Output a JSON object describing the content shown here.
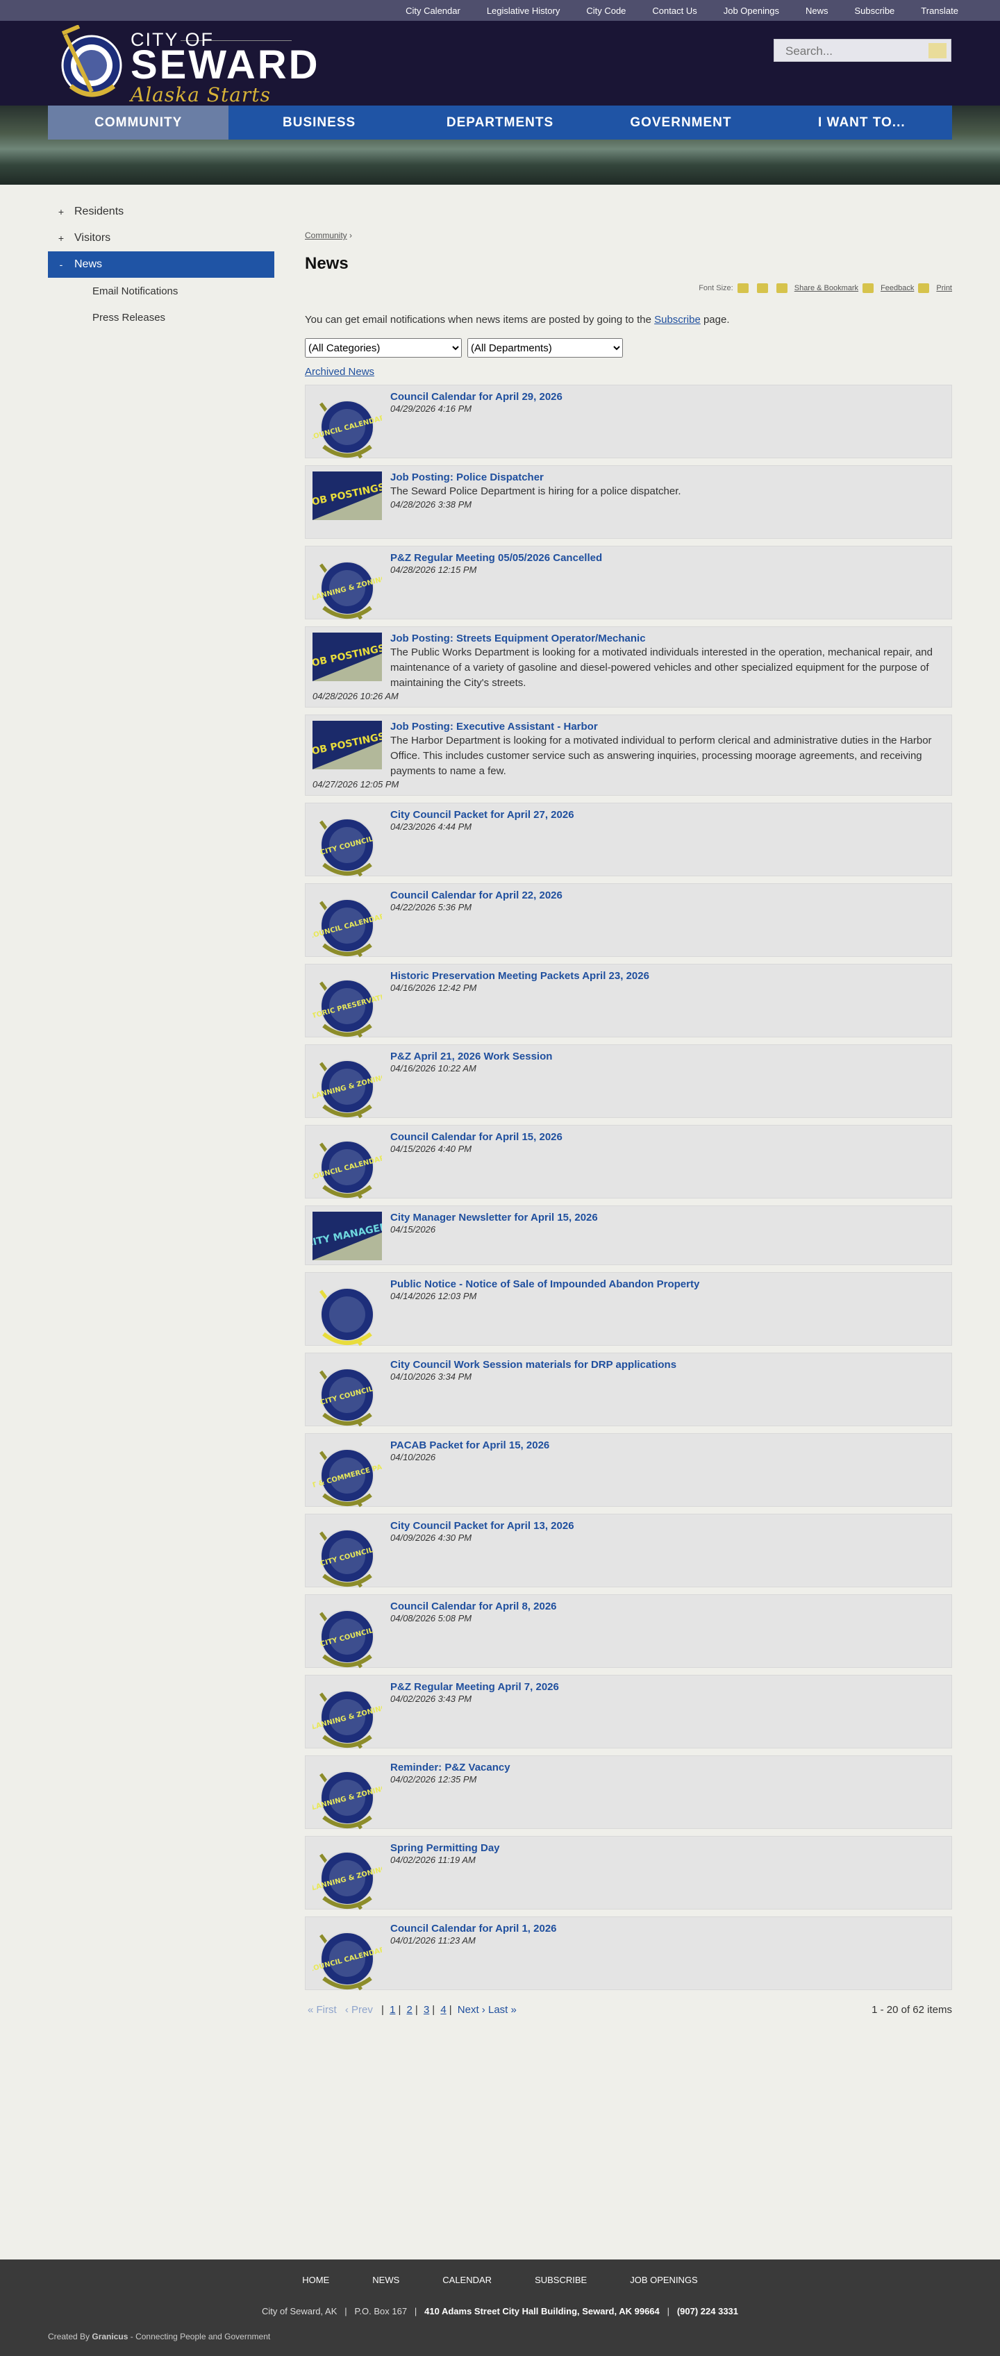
{
  "topnav": [
    "City Calendar",
    "Legislative History",
    "City Code",
    "Contact Us",
    "Job Openings",
    "News",
    "Subscribe",
    "Translate"
  ],
  "logo": {
    "line1": "CITY OF",
    "line2": "SEWARD",
    "tagline": "Alaska Starts Here...",
    "seal_text": "CITY OF SEWARD ALASKA"
  },
  "search": {
    "placeholder": "Search..."
  },
  "mainnav": [
    {
      "label": "COMMUNITY",
      "active": true
    },
    {
      "label": "BUSINESS"
    },
    {
      "label": "DEPARTMENTS"
    },
    {
      "label": "GOVERNMENT"
    },
    {
      "label": "I WANT TO..."
    }
  ],
  "sidebar": {
    "items": [
      {
        "toggle": "+",
        "label": "Residents"
      },
      {
        "toggle": "+",
        "label": "Visitors"
      },
      {
        "toggle": "-",
        "label": "News",
        "active": true
      }
    ],
    "subitems": [
      "Email Notifications",
      "Press Releases"
    ]
  },
  "breadcrumb": {
    "link": "Community",
    "sep": "›"
  },
  "page": {
    "title": "News",
    "font_size_label": "Font Size:",
    "share_label": "Share & Bookmark",
    "feedback_label": "Feedback",
    "print_label": "Print",
    "intro_pre": "You can get email notifications when news items are posted by going to the",
    "intro_link": "Subscribe",
    "intro_post": "page.",
    "filter_categories": "(All Categories)",
    "filter_departments": "(All Departments)",
    "archived_label": "Archived News"
  },
  "news": [
    {
      "title": "Council Calendar for April 29, 2026",
      "desc": "",
      "date": "04/29/2026 4:16 PM",
      "thumb": "seal",
      "thumb_text": "COUNCIL CALENDAR"
    },
    {
      "title": "Job Posting: Police Dispatcher",
      "desc": "The Seward Police Department is hiring for a police dispatcher.",
      "date": "04/28/2026 3:38 PM",
      "thumb": "job",
      "thumb_text": "JOB POSTINGS"
    },
    {
      "title": "P&Z Regular Meeting 05/05/2026 Cancelled",
      "desc": "",
      "date": "04/28/2026 12:15 PM",
      "thumb": "seal",
      "thumb_text": "PLANNING & ZONING"
    },
    {
      "title": "Job Posting: Streets Equipment Operator/Mechanic",
      "desc": "The Public Works Department is looking for a motivated individuals interested in the operation, mechanical repair, and maintenance of a variety of gasoline and diesel-powered vehicles and other specialized equipment for the purpose of maintaining the City's streets.",
      "date": "04/28/2026 10:26 AM",
      "thumb": "job",
      "thumb_text": "JOB POSTINGS",
      "wide": true
    },
    {
      "title": "Job Posting: Executive Assistant - Harbor",
      "desc": "The Harbor Department is looking for a motivated individual to perform clerical and administrative duties in the Harbor Office. This includes customer service such as answering inquiries, processing moorage agreements, and receiving payments to name a few.",
      "date": "04/27/2026 12:05 PM",
      "thumb": "job",
      "thumb_text": "JOB POSTINGS",
      "wide": true
    },
    {
      "title": "City Council Packet for April 27, 2026",
      "desc": "",
      "date": "04/23/2026 4:44 PM",
      "thumb": "seal",
      "thumb_text": "CITY COUNCIL"
    },
    {
      "title": "Council Calendar for April 22, 2026",
      "desc": "",
      "date": "04/22/2026 5:36 PM",
      "thumb": "seal",
      "thumb_text": "COUNCIL CALENDAR"
    },
    {
      "title": "Historic Preservation Meeting Packets April 23, 2026",
      "desc": "",
      "date": "04/16/2026 12:42 PM",
      "thumb": "seal",
      "thumb_text": "HISTORIC PRESERVATION"
    },
    {
      "title": "P&Z April 21, 2026 Work Session",
      "desc": "",
      "date": "04/16/2026 10:22 AM",
      "thumb": "seal",
      "thumb_text": "PLANNING & ZONING"
    },
    {
      "title": "Council Calendar for April 15, 2026",
      "desc": "",
      "date": "04/15/2026 4:40 PM",
      "thumb": "seal",
      "thumb_text": "COUNCIL CALENDAR"
    },
    {
      "title": "City Manager Newsletter for April 15, 2026",
      "desc": "",
      "date": "04/15/2026",
      "thumb": "manager",
      "thumb_text": "CITY MANAGER",
      "short": true
    },
    {
      "title": "Public Notice - Notice of Sale of Impounded Abandon Property",
      "desc": "",
      "date": "04/14/2026 12:03 PM",
      "thumb": "seal2",
      "thumb_text": ""
    },
    {
      "title": "City Council Work Session materials for DRP applications",
      "desc": "",
      "date": "04/10/2026 3:34 PM",
      "thumb": "seal",
      "thumb_text": "CITY COUNCIL"
    },
    {
      "title": "PACAB Packet for April 15, 2026",
      "desc": "",
      "date": "04/10/2026",
      "thumb": "seal",
      "thumb_text": "PORT & COMMERCE PACAB"
    },
    {
      "title": "City Council Packet for April 13, 2026",
      "desc": "",
      "date": "04/09/2026 4:30 PM",
      "thumb": "seal",
      "thumb_text": "CITY COUNCIL"
    },
    {
      "title": "Council Calendar for April 8, 2026",
      "desc": "",
      "date": "04/08/2026 5:08 PM",
      "thumb": "seal",
      "thumb_text": "CITY COUNCIL"
    },
    {
      "title": "P&Z Regular Meeting April 7, 2026",
      "desc": "",
      "date": "04/02/2026 3:43 PM",
      "thumb": "seal",
      "thumb_text": "PLANNING & ZONING"
    },
    {
      "title": "Reminder: P&Z Vacancy",
      "desc": "",
      "date": "04/02/2026 12:35 PM",
      "thumb": "seal",
      "thumb_text": "PLANNING & ZONING"
    },
    {
      "title": "Spring Permitting Day",
      "desc": "",
      "date": "04/02/2026 11:19 AM",
      "thumb": "seal",
      "thumb_text": "PLANNING & ZONING"
    },
    {
      "title": "Council Calendar for April 1, 2026",
      "desc": "",
      "date": "04/01/2026 11:23 AM",
      "thumb": "seal",
      "thumb_text": "COUNCIL CALENDAR"
    }
  ],
  "pager": {
    "first": "« First",
    "prev": "‹ Prev",
    "pages": [
      "1",
      "2",
      "3",
      "4"
    ],
    "next": "Next ›",
    "last": "Last »",
    "summary": "1 - 20 of 62 items"
  },
  "footer": {
    "nav": [
      "HOME",
      "NEWS",
      "CALENDAR",
      "SUBSCRIBE",
      "JOB OPENINGS"
    ],
    "org": "City of Seward, AK",
    "pobox": "P.O. Box 167",
    "address": "410 Adams Street City Hall Building, Seward, AK 99664",
    "phone": "(907) 224 3331",
    "created_pre": "Created By",
    "created_brand": "Granicus",
    "created_post": "- Connecting People and Government"
  }
}
